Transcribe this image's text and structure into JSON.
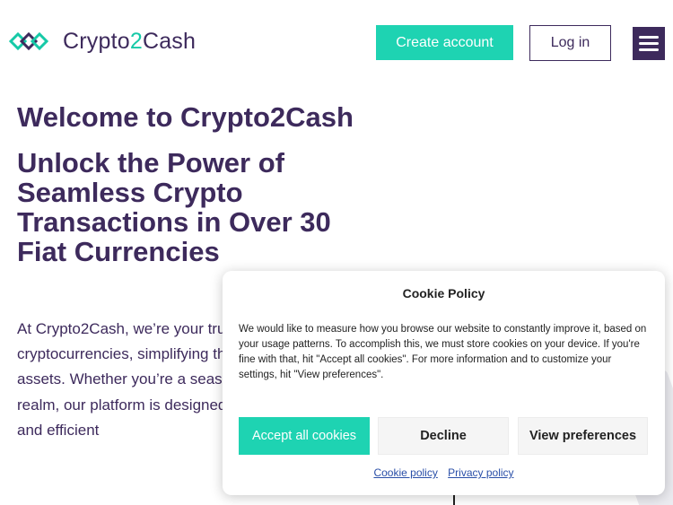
{
  "header": {
    "logo_text_main": "Crypto",
    "logo_text_accent": "2",
    "logo_text_end": "Cash",
    "create_account_label": "Create account",
    "login_label": "Log in",
    "menu_icon": "hamburger-menu-icon"
  },
  "main": {
    "welcome": "Welcome to Crypto2Cash",
    "headline": "Unlock the Power of Seamless Crypto Transactions in Over 30 Fiat Currencies",
    "intro": "At Crypto2Cash, we’re your trusted partner in navigating the world of cryptocurrencies, simplifying the process of buying and selling digital assets. Whether you’re a seasoned investor or just starting in the crypto realm, our platform is designed to help you experience smooth, secure, and efficient"
  },
  "cookie_banner": {
    "title": "Cookie Policy",
    "text": "We would like to measure how you browse our website to constantly improve it, based on your usage patterns. To accomplish this, we must store cookies on your device. If you're fine with that, hit \"Accept all cookies\". For more information and to customize your settings, hit \"View preferences\".",
    "accept_label": "Accept all cookies",
    "decline_label": "Decline",
    "preferences_label": "View preferences",
    "cookie_policy_link": "Cookie policy",
    "privacy_policy_link": "Privacy policy"
  },
  "colors": {
    "brand_purple": "#3d2a5c",
    "brand_teal": "#1ed3b2"
  }
}
